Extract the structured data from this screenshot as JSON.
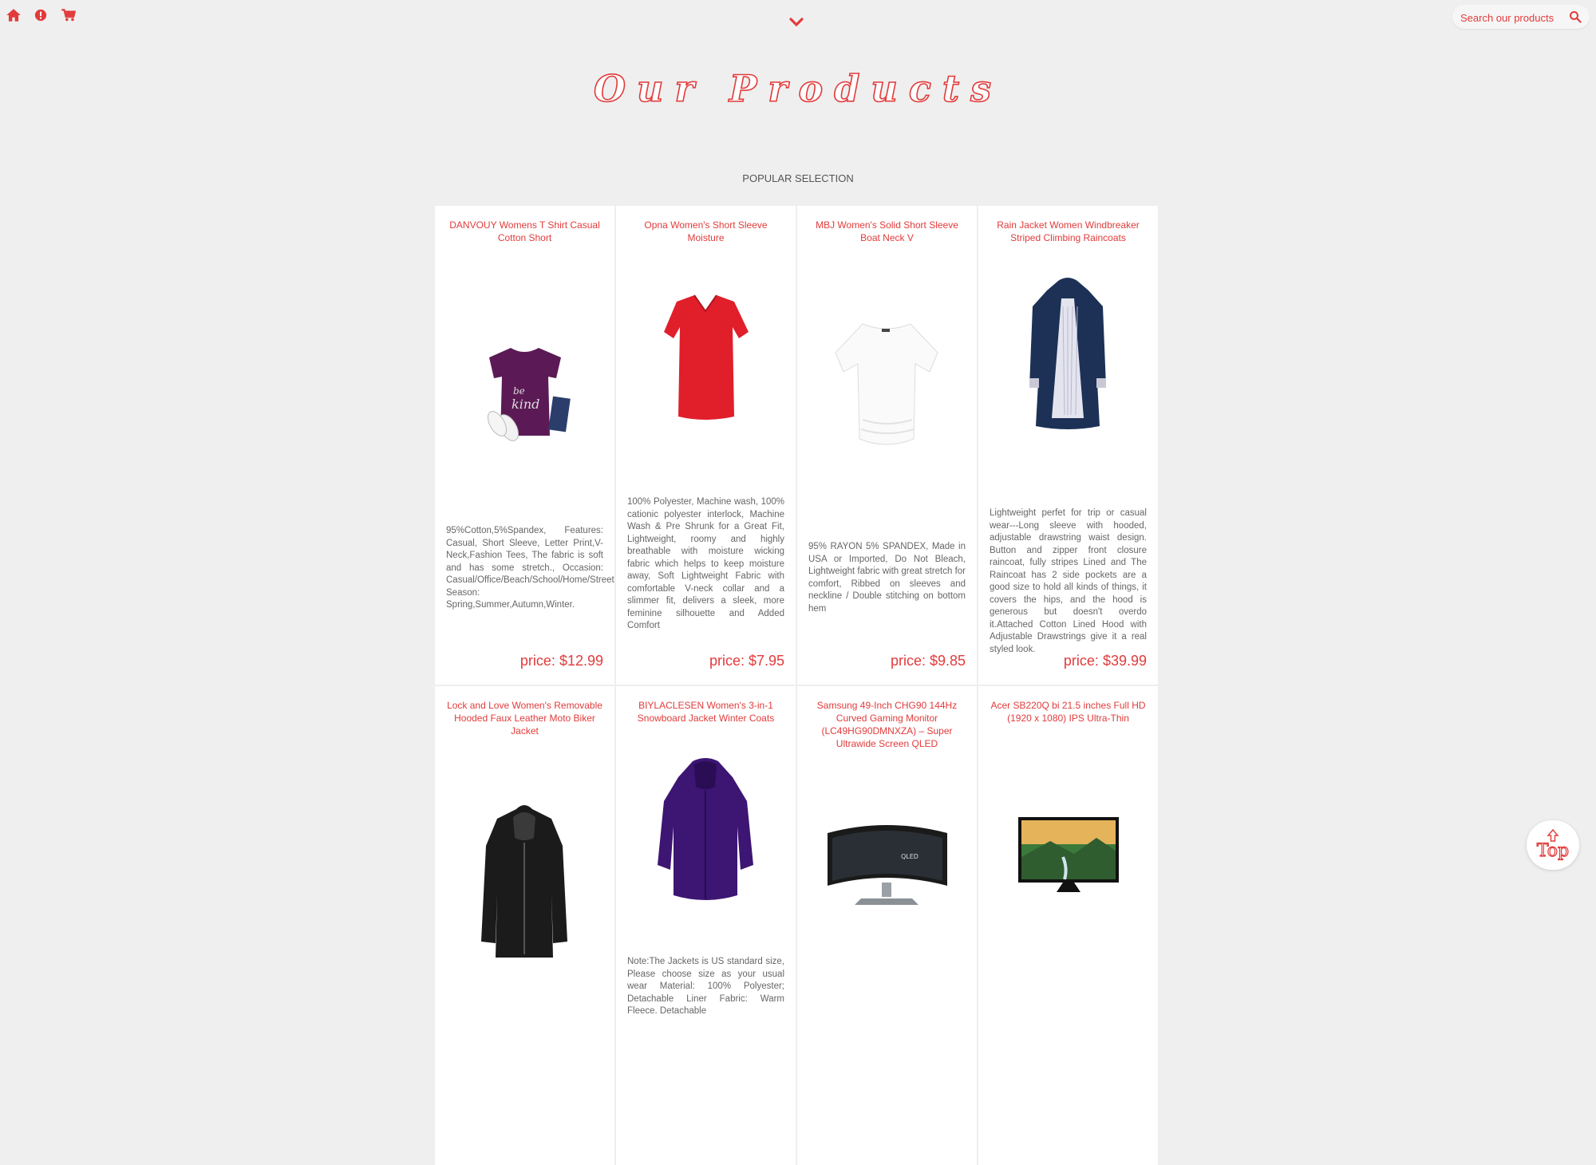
{
  "nav": {
    "icons": [
      "home-icon",
      "info-icon",
      "cart-icon"
    ],
    "chevron": "chevron-down-icon",
    "search_placeholder": "Search our products",
    "search_icon": "search-icon"
  },
  "header": {
    "title": "Our Products",
    "subtitle": "POPULAR SELECTION"
  },
  "colors": {
    "accent": "#e23b3b",
    "background": "#efefef",
    "card": "#ffffff",
    "text": "#666666"
  },
  "products": [
    {
      "title": "DANVOUY Womens T Shirt Casual Cotton Short",
      "description": "95%Cotton,5%Spandex, Features: Casual, Short Sleeve, Letter Print,V-Neck,Fashion Tees, The fabric is soft and has some stretch., Occasion: Casual/Office/Beach/School/Home/Street. Season: Spring,Summer,Autumn,Winter.",
      "price": "price: $12.99",
      "image": "purple-tshirt"
    },
    {
      "title": "Opna Women's Short Sleeve Moisture",
      "description": "100% Polyester, Machine wash, 100% cationic polyester interlock, Machine Wash & Pre Shrunk for a Great Fit, Lightweight, roomy and highly breathable with moisture wicking fabric which helps to keep moisture away, Soft Lightweight Fabric with comfortable V-neck collar and a slimmer fit, delivers a sleek, more feminine silhouette and Added Comfort",
      "price": "price: $7.95",
      "image": "red-tshirt"
    },
    {
      "title": "MBJ Women's Solid Short Sleeve Boat Neck V",
      "description": "95% RAYON 5% SPANDEX, Made in USA or Imported, Do Not Bleach, Lightweight fabric with great stretch for comfort, Ribbed on sleeves and neckline / Double stitching on bottom hem",
      "price": "price: $9.85",
      "image": "white-top"
    },
    {
      "title": "Rain Jacket Women Windbreaker Striped Climbing Raincoats",
      "description": "Lightweight perfet for trip or casual wear---Long sleeve with hooded, adjustable drawstring waist design. Button and zipper front closure raincoat, fully stripes Lined and The Raincoat has 2 side pockets are a good size to hold all kinds of things, it covers the hips, and the hood is generous but doesn't overdo it.Attached Cotton Lined Hood with Adjustable Drawstrings give it a real styled look.",
      "price": "price: $39.99",
      "image": "navy-raincoat"
    },
    {
      "title": "Lock and Love Women's Removable Hooded Faux Leather Moto Biker Jacket",
      "description": "",
      "price": "",
      "image": "black-leather-jacket"
    },
    {
      "title": "BIYLACLESEN Women's 3-in-1 Snowboard Jacket Winter Coats",
      "description": "Note:The Jackets is US standard size, Please choose size as your usual wear Material: 100% Polyester; Detachable Liner Fabric: Warm Fleece. Detachable",
      "price": "",
      "image": "purple-winter-jacket"
    },
    {
      "title": "Samsung 49-Inch CHG90 144Hz Curved Gaming Monitor (LC49HG90DMNXZA) – Super Ultrawide Screen QLED",
      "description": "",
      "price": "",
      "image": "curved-monitor"
    },
    {
      "title": "Acer SB220Q bi 21.5 inches Full HD (1920 x 1080) IPS Ultra-Thin",
      "description": "",
      "price": "",
      "image": "flat-monitor"
    }
  ],
  "top_button": {
    "label": "Top",
    "icon": "arrow-up-icon"
  }
}
